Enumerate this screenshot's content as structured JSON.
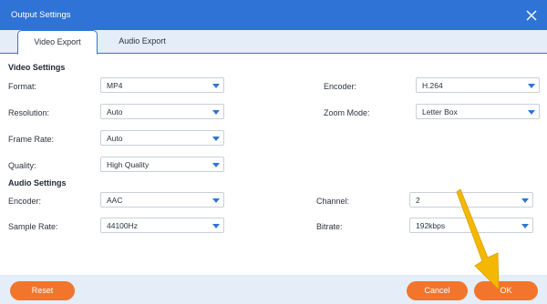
{
  "window": {
    "title": "Output Settings"
  },
  "tabs": [
    {
      "label": "Video Export",
      "active": true
    },
    {
      "label": "Audio Export",
      "active": false
    }
  ],
  "video_settings": {
    "heading": "Video Settings",
    "format": {
      "label": "Format:",
      "value": "MP4"
    },
    "encoder": {
      "label": "Encoder:",
      "value": "H.264"
    },
    "resolution": {
      "label": "Resolution:",
      "value": "Auto"
    },
    "zoom_mode": {
      "label": "Zoom Mode:",
      "value": "Letter Box"
    },
    "frame_rate": {
      "label": "Frame Rate:",
      "value": "Auto"
    },
    "quality": {
      "label": "Quality:",
      "value": "High Quality"
    }
  },
  "audio_settings": {
    "heading": "Audio Settings",
    "encoder": {
      "label": "Encoder:",
      "value": "AAC"
    },
    "channel": {
      "label": "Channel:",
      "value": "2"
    },
    "sample_rate": {
      "label": "Sample Rate:",
      "value": "44100Hz"
    },
    "bitrate": {
      "label": "Bitrate:",
      "value": "192kbps"
    }
  },
  "buttons": {
    "reset": "Reset",
    "cancel": "Cancel",
    "ok": "OK"
  },
  "colors": {
    "titlebar": "#2f73d6",
    "accent": "#2f73d6",
    "button": "#f2752b",
    "footer": "#e5edf8",
    "pointer_arrow": "#f5b800"
  }
}
